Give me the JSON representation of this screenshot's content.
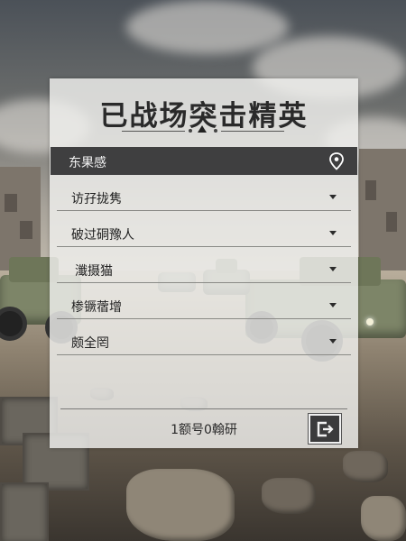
{
  "app": {
    "title": "已战场突击精英"
  },
  "server": {
    "label": "东果感",
    "icon": "location-pin-icon"
  },
  "options": [
    {
      "label": "访孖拢隽"
    },
    {
      "label": "破过硐豫人"
    },
    {
      "label": "瀸摄猫"
    },
    {
      "label": "椮镢蓿增"
    },
    {
      "label": "颇全罔"
    }
  ],
  "footer": {
    "login_text": "1额号0翰研",
    "exit_icon": "exit-icon"
  },
  "colors": {
    "panel_bg": "#f0f0ee",
    "header_bar": "#3f3f40",
    "accent_dark": "#3b3b3c"
  }
}
